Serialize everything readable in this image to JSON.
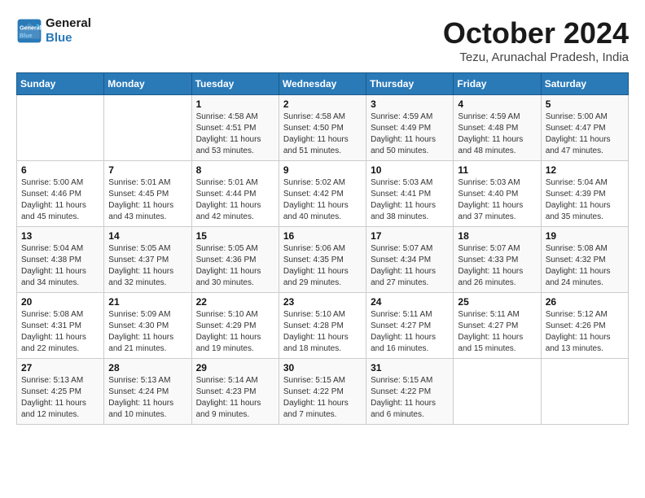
{
  "header": {
    "logo_line1": "General",
    "logo_line2": "Blue",
    "month_title": "October 2024",
    "subtitle": "Tezu, Arunachal Pradesh, India"
  },
  "days_of_week": [
    "Sunday",
    "Monday",
    "Tuesday",
    "Wednesday",
    "Thursday",
    "Friday",
    "Saturday"
  ],
  "weeks": [
    [
      {
        "day": "",
        "info": ""
      },
      {
        "day": "",
        "info": ""
      },
      {
        "day": "1",
        "info": "Sunrise: 4:58 AM\nSunset: 4:51 PM\nDaylight: 11 hours and 53 minutes."
      },
      {
        "day": "2",
        "info": "Sunrise: 4:58 AM\nSunset: 4:50 PM\nDaylight: 11 hours and 51 minutes."
      },
      {
        "day": "3",
        "info": "Sunrise: 4:59 AM\nSunset: 4:49 PM\nDaylight: 11 hours and 50 minutes."
      },
      {
        "day": "4",
        "info": "Sunrise: 4:59 AM\nSunset: 4:48 PM\nDaylight: 11 hours and 48 minutes."
      },
      {
        "day": "5",
        "info": "Sunrise: 5:00 AM\nSunset: 4:47 PM\nDaylight: 11 hours and 47 minutes."
      }
    ],
    [
      {
        "day": "6",
        "info": "Sunrise: 5:00 AM\nSunset: 4:46 PM\nDaylight: 11 hours and 45 minutes."
      },
      {
        "day": "7",
        "info": "Sunrise: 5:01 AM\nSunset: 4:45 PM\nDaylight: 11 hours and 43 minutes."
      },
      {
        "day": "8",
        "info": "Sunrise: 5:01 AM\nSunset: 4:44 PM\nDaylight: 11 hours and 42 minutes."
      },
      {
        "day": "9",
        "info": "Sunrise: 5:02 AM\nSunset: 4:42 PM\nDaylight: 11 hours and 40 minutes."
      },
      {
        "day": "10",
        "info": "Sunrise: 5:03 AM\nSunset: 4:41 PM\nDaylight: 11 hours and 38 minutes."
      },
      {
        "day": "11",
        "info": "Sunrise: 5:03 AM\nSunset: 4:40 PM\nDaylight: 11 hours and 37 minutes."
      },
      {
        "day": "12",
        "info": "Sunrise: 5:04 AM\nSunset: 4:39 PM\nDaylight: 11 hours and 35 minutes."
      }
    ],
    [
      {
        "day": "13",
        "info": "Sunrise: 5:04 AM\nSunset: 4:38 PM\nDaylight: 11 hours and 34 minutes."
      },
      {
        "day": "14",
        "info": "Sunrise: 5:05 AM\nSunset: 4:37 PM\nDaylight: 11 hours and 32 minutes."
      },
      {
        "day": "15",
        "info": "Sunrise: 5:05 AM\nSunset: 4:36 PM\nDaylight: 11 hours and 30 minutes."
      },
      {
        "day": "16",
        "info": "Sunrise: 5:06 AM\nSunset: 4:35 PM\nDaylight: 11 hours and 29 minutes."
      },
      {
        "day": "17",
        "info": "Sunrise: 5:07 AM\nSunset: 4:34 PM\nDaylight: 11 hours and 27 minutes."
      },
      {
        "day": "18",
        "info": "Sunrise: 5:07 AM\nSunset: 4:33 PM\nDaylight: 11 hours and 26 minutes."
      },
      {
        "day": "19",
        "info": "Sunrise: 5:08 AM\nSunset: 4:32 PM\nDaylight: 11 hours and 24 minutes."
      }
    ],
    [
      {
        "day": "20",
        "info": "Sunrise: 5:08 AM\nSunset: 4:31 PM\nDaylight: 11 hours and 22 minutes."
      },
      {
        "day": "21",
        "info": "Sunrise: 5:09 AM\nSunset: 4:30 PM\nDaylight: 11 hours and 21 minutes."
      },
      {
        "day": "22",
        "info": "Sunrise: 5:10 AM\nSunset: 4:29 PM\nDaylight: 11 hours and 19 minutes."
      },
      {
        "day": "23",
        "info": "Sunrise: 5:10 AM\nSunset: 4:28 PM\nDaylight: 11 hours and 18 minutes."
      },
      {
        "day": "24",
        "info": "Sunrise: 5:11 AM\nSunset: 4:27 PM\nDaylight: 11 hours and 16 minutes."
      },
      {
        "day": "25",
        "info": "Sunrise: 5:11 AM\nSunset: 4:27 PM\nDaylight: 11 hours and 15 minutes."
      },
      {
        "day": "26",
        "info": "Sunrise: 5:12 AM\nSunset: 4:26 PM\nDaylight: 11 hours and 13 minutes."
      }
    ],
    [
      {
        "day": "27",
        "info": "Sunrise: 5:13 AM\nSunset: 4:25 PM\nDaylight: 11 hours and 12 minutes."
      },
      {
        "day": "28",
        "info": "Sunrise: 5:13 AM\nSunset: 4:24 PM\nDaylight: 11 hours and 10 minutes."
      },
      {
        "day": "29",
        "info": "Sunrise: 5:14 AM\nSunset: 4:23 PM\nDaylight: 11 hours and 9 minutes."
      },
      {
        "day": "30",
        "info": "Sunrise: 5:15 AM\nSunset: 4:22 PM\nDaylight: 11 hours and 7 minutes."
      },
      {
        "day": "31",
        "info": "Sunrise: 5:15 AM\nSunset: 4:22 PM\nDaylight: 11 hours and 6 minutes."
      },
      {
        "day": "",
        "info": ""
      },
      {
        "day": "",
        "info": ""
      }
    ]
  ]
}
